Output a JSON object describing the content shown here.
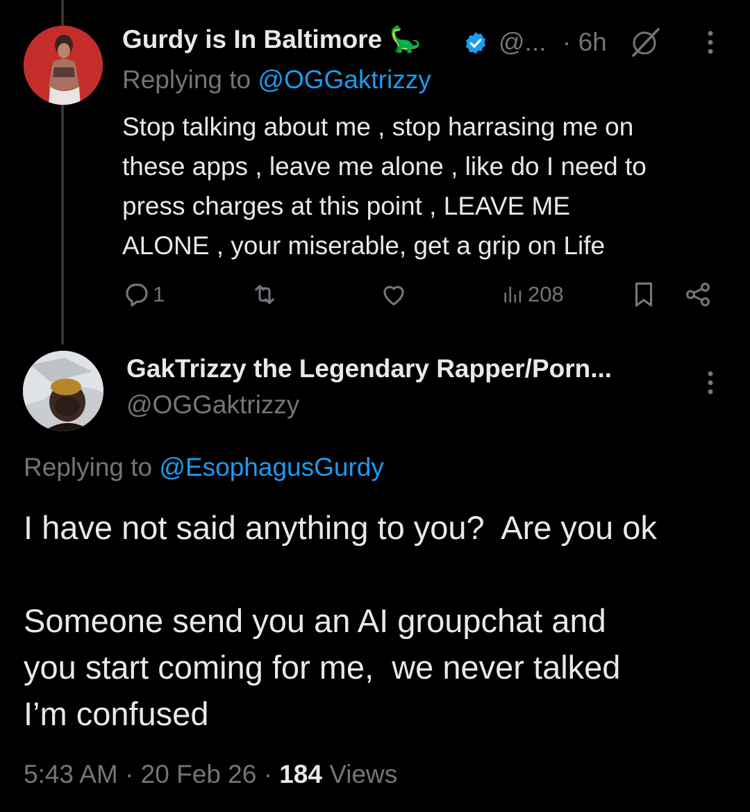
{
  "parent_tweet": {
    "author_name": "Gurdy is In Baltimore",
    "name_emoji": "🦕",
    "handle_truncated": "@...",
    "time": "· 6h",
    "replying_prefix": "Replying to",
    "replying_handle": "@OGGaktrizzy",
    "text": "Stop talking about me , stop harrasing me on\nthese apps , leave me alone , like do I need to\npress charges at this point , LEAVE ME\nALONE , your miserable, get a grip on Life",
    "replies_count": "1",
    "views_count": "208",
    "colors": {
      "verified": "#1d9bf0",
      "link": "#1d9bf0",
      "muted": "#71767b"
    }
  },
  "main_tweet": {
    "author_name": "GakTrizzy the Legendary Rapper/Porn...",
    "handle": "@OGGaktrizzy",
    "replying_prefix": "Replying to",
    "replying_handle": "@EsophagusGurdy",
    "text": "I have not said anything to you?  Are you ok\n\nSomeone send you an AI groupchat and\nyou start coming for me,  we never talked\nI’m confused",
    "time": "5:43 AM",
    "date": "20 Feb 26",
    "views_count": "184",
    "views_label": "Views",
    "separator": "·"
  },
  "icons": [
    "verified-badge-icon",
    "grok-icon",
    "more-icon",
    "reply-icon",
    "retweet-icon",
    "like-icon",
    "views-icon",
    "bookmark-icon",
    "share-icon"
  ]
}
